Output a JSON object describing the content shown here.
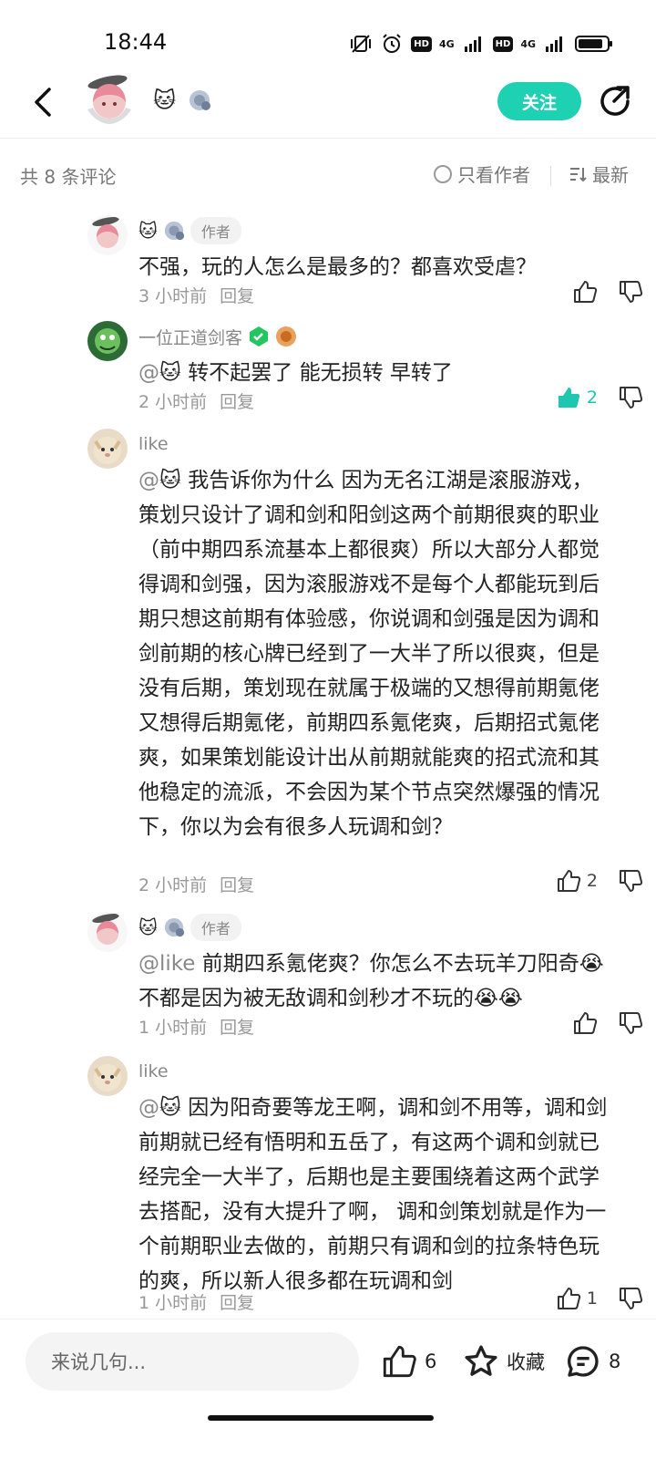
{
  "status": {
    "time": "18:44",
    "net1": "4G",
    "net2": "4G",
    "hd": "HD"
  },
  "header": {
    "follow_label": "关注"
  },
  "subheader": {
    "count_text": "共 8 条评论",
    "only_author_label": "只看作者",
    "sort_label": "最新"
  },
  "replies": [
    {
      "name": "",
      "author_tag": "作者",
      "text": "不强，玩的人怎么是最多的？都喜欢受虐？",
      "mention": "",
      "time": "3 小时前",
      "reply_label": "回复",
      "likes": ""
    },
    {
      "name": "一位正道剑客",
      "author_tag": "",
      "mention": "@",
      "text": "  转不起罢了 能无损转 早转了",
      "time": "2 小时前",
      "reply_label": "回复",
      "likes": "2"
    },
    {
      "name": "like",
      "author_tag": "",
      "mention": "@",
      "text": "  我告诉你为什么 因为无名江湖是滚服游戏，策划只设计了调和剑和阳剑这两个前期很爽的职业（前中期四系流基本上都很爽）所以大部分人都觉得调和剑强，因为滚服游戏不是每个人都能玩到后期只想这前期有体验感，你说调和剑强是因为调和剑前期的核心牌已经到了一大半了所以很爽，但是没有后期，策划现在就属于极端的又想得前期氪佬又想得后期氪佬，前期四系氪佬爽，后期招式氪佬爽，如果策划能设计出从前期就能爽的招式流和其他稳定的流派，不会因为某个节点突然爆强的情况下，你以为会有很多人玩调和剑？",
      "time": "2 小时前",
      "reply_label": "回复",
      "likes": "2"
    },
    {
      "name": "",
      "author_tag": "作者",
      "mention": "@like",
      "text": "  前期四系氪佬爽？你怎么不去玩羊刀阳奇😭不都是因为被无敌调和剑秒才不玩的😭😭",
      "time": "1 小时前",
      "reply_label": "回复",
      "likes": ""
    },
    {
      "name": "like",
      "author_tag": "",
      "mention": "@",
      "text": "  因为阳奇要等龙王啊，调和剑不用等，调和剑前期就已经有悟明和五岳了，有这两个调和剑就已经完全一大半了，后期也是主要围绕着这两个武学去搭配，没有大提升了啊， 调和剑策划就是作为一个前期职业去做的，前期只有调和剑的拉条特色玩的爽，所以新人很多都在玩调和剑",
      "time": "1 小时前",
      "reply_label": "回复",
      "likes": "1"
    }
  ],
  "bottom": {
    "input_placeholder": "来说几句...",
    "like_count": "6",
    "fav_label": "收藏",
    "comment_count": "8"
  },
  "colors": {
    "accent": "#1ed1b3",
    "muted": "#888888"
  }
}
